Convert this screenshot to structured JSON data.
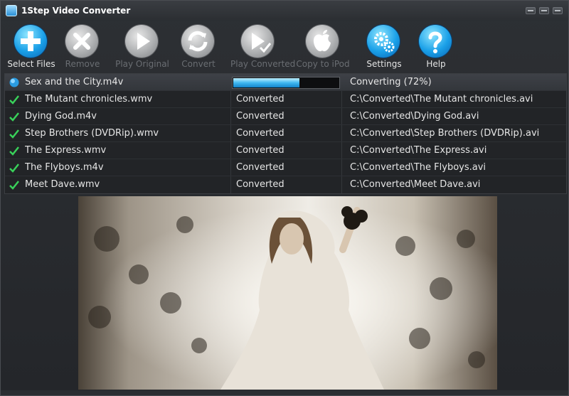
{
  "window": {
    "title": "1Step Video Converter"
  },
  "toolbar": {
    "buttons": [
      {
        "label": "Select Files",
        "icon": "plus-icon",
        "enabled": true
      },
      {
        "label": "Remove",
        "icon": "x-icon",
        "enabled": false
      },
      {
        "label": "Play Original",
        "icon": "play-icon",
        "enabled": false
      },
      {
        "label": "Convert",
        "icon": "refresh-icon",
        "enabled": false
      },
      {
        "label": "Play Converted",
        "icon": "play-check-icon",
        "enabled": false
      },
      {
        "label": "Copy to iPod",
        "icon": "apple-icon",
        "enabled": false
      },
      {
        "label": "Settings",
        "icon": "gears-icon",
        "enabled": true
      },
      {
        "label": "Help",
        "icon": "question-icon",
        "enabled": true
      }
    ]
  },
  "files": [
    {
      "name": "Sex and the City.m4v",
      "status": "",
      "progress": 0.63,
      "output": "Converting (72%)",
      "state": "converting"
    },
    {
      "name": "The Mutant chronicles.wmv",
      "status": "Converted",
      "output": "C:\\Converted\\The Mutant chronicles.avi",
      "state": "done"
    },
    {
      "name": "Dying God.m4v",
      "status": "Converted",
      "output": "C:\\Converted\\Dying God.avi",
      "state": "done"
    },
    {
      "name": "Step Brothers (DVDRip).wmv",
      "status": "Converted",
      "output": "C:\\Converted\\Step Brothers (DVDRip).avi",
      "state": "done"
    },
    {
      "name": "The Express.wmv",
      "status": "Converted",
      "output": "C:\\Converted\\The Express.avi",
      "state": "done"
    },
    {
      "name": "The Flyboys.m4v",
      "status": "Converted",
      "output": "C:\\Converted\\The Flyboys.avi",
      "state": "done"
    },
    {
      "name": "Meet Dave.wmv",
      "status": "Converted",
      "output": "C:\\Converted\\Meet Dave.avi",
      "state": "done"
    }
  ],
  "colors": {
    "accent_blue": "#1aa0e8",
    "check_green": "#39d15a"
  }
}
